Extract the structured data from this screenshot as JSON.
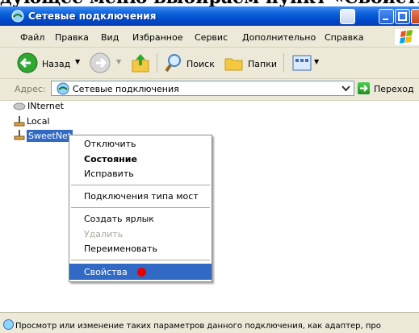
{
  "clipped_caption": "дующее меню выбираем пункт «Свойства»",
  "window": {
    "title": "Сетевые подключения"
  },
  "menu": [
    "Файл",
    "Правка",
    "Вид",
    "Избранное",
    "Сервис",
    "Дополнительно",
    "Справка"
  ],
  "toolbar": {
    "back_label": "Назад",
    "search_label": "Поиск",
    "folders_label": "Папки"
  },
  "address": {
    "label": "Адрес:",
    "value": "Сетевые подключения",
    "go_label": "Переход"
  },
  "connections": [
    {
      "name": "INternet",
      "selected": false
    },
    {
      "name": "Local",
      "selected": false
    },
    {
      "name": "SweetNet",
      "selected": true
    }
  ],
  "context_menu": {
    "items": [
      {
        "label": "Отключить",
        "bold": false,
        "disabled": false
      },
      {
        "label": "Состояние",
        "bold": true,
        "disabled": false
      },
      {
        "label": "Исправить",
        "bold": false,
        "disabled": false
      },
      {
        "label": "Подключения типа мост",
        "bold": false,
        "disabled": false
      },
      {
        "label": "Создать ярлык",
        "bold": false,
        "disabled": false
      },
      {
        "label": "Удалить",
        "bold": false,
        "disabled": true
      },
      {
        "label": "Переименовать",
        "bold": false,
        "disabled": false
      },
      {
        "label": "Свойства",
        "bold": false,
        "disabled": false,
        "highlighted": true
      }
    ]
  },
  "status": {
    "text": "Просмотр или изменение таких параметров данного подключения, как адаптер, про"
  },
  "colors": {
    "titlebar": "#0a5fd8",
    "selection": "#316ac5",
    "marker": "#e80000",
    "chrome": "#ece9d8"
  }
}
